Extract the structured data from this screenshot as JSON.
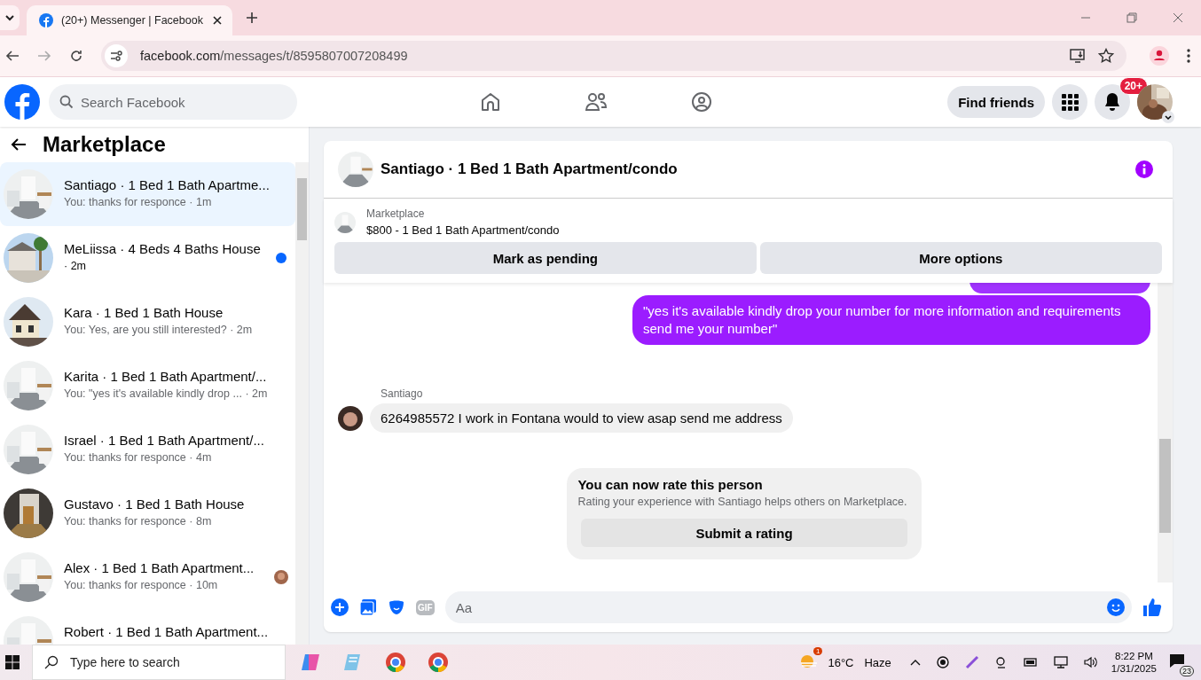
{
  "browser": {
    "tab_title": "(20+) Messenger | Facebook",
    "url_domain": "facebook.com",
    "url_path": "/messages/t/8595807007208499"
  },
  "topbar": {
    "search_placeholder": "Search Facebook",
    "find_friends": "Find friends",
    "notification_badge": "20+"
  },
  "sidebar": {
    "title": "Marketplace",
    "conversations": [
      {
        "title": "Santiago · 1 Bed 1 Bath Apartme...",
        "subtitle": "You: thanks for responce · 1m",
        "selected": true,
        "unread": false,
        "seen": false
      },
      {
        "title": "MeLiissa · 4 Beds 4 Baths House",
        "subtitle": "· 2m",
        "selected": false,
        "unread": true,
        "seen": false
      },
      {
        "title": "Kara · 1 Bed 1 Bath House",
        "subtitle": "You: Yes, are you still interested? · 2m",
        "selected": false,
        "unread": false,
        "seen": false
      },
      {
        "title": "Karita · 1 Bed 1 Bath Apartment/...",
        "subtitle": "You: \"yes it's available kindly drop ... · 2m",
        "selected": false,
        "unread": false,
        "seen": false
      },
      {
        "title": "Israel · 1 Bed 1 Bath Apartment/...",
        "subtitle": "You: thanks for responce · 4m",
        "selected": false,
        "unread": false,
        "seen": false
      },
      {
        "title": "Gustavo · 1 Bed 1 Bath House",
        "subtitle": "You: thanks for responce · 8m",
        "selected": false,
        "unread": false,
        "seen": false
      },
      {
        "title": "Alex · 1 Bed 1 Bath Apartment...",
        "subtitle": "You: thanks for responce · 10m",
        "selected": false,
        "unread": false,
        "seen": true
      },
      {
        "title": "Robert · 1 Bed 1 Bath Apartment...",
        "selected": false,
        "unread": false,
        "seen": false
      }
    ]
  },
  "chat": {
    "title": "Santiago · 1 Bed 1 Bath Apartment/condo",
    "listing_label": "Marketplace",
    "listing_text": "$800 - 1 Bed 1 Bath Apartment/condo",
    "actions": [
      "Mark as pending",
      "More options"
    ],
    "messages": [
      {
        "kind": "outgoing_partial"
      },
      {
        "kind": "outgoing",
        "text": "\"yes it's available kindly drop your number for more information and requirements send me your number\""
      },
      {
        "kind": "incoming",
        "sender": "Santiago",
        "text": "6264985572 I work in Fontana would to view asap  send me address"
      },
      {
        "kind": "rating",
        "title": "You can now rate this person",
        "text": "Rating your experience with Santiago helps others on Marketplace.",
        "button": "Submit a rating"
      }
    ],
    "gif_label": "GIF",
    "composer_placeholder": "Aa"
  },
  "taskbar": {
    "search_placeholder": "Type here to search",
    "weather_badge": "1",
    "temperature": "16°C",
    "condition": "Haze",
    "time": "8:22 PM",
    "date": "1/31/2025",
    "notification_count": "23"
  }
}
